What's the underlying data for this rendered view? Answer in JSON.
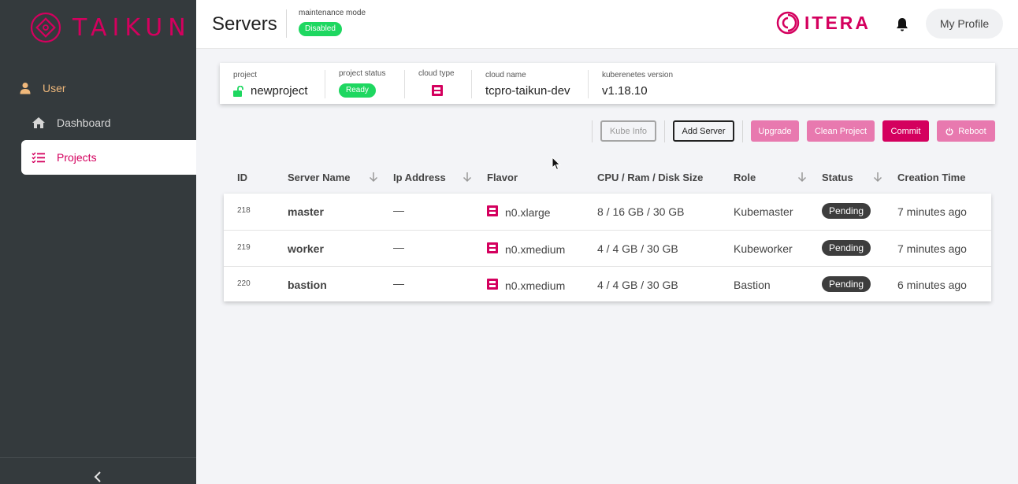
{
  "app": {
    "brand": "TAIKUN",
    "partner_brand": "ITERA",
    "accent_color": "#d4005e"
  },
  "sidebar": {
    "items": [
      {
        "label": "User",
        "icon": "user-icon"
      },
      {
        "label": "Dashboard",
        "icon": "home-icon"
      },
      {
        "label": "Projects",
        "icon": "list-icon",
        "active": true
      }
    ],
    "collapse_icon": "chevron-left-icon"
  },
  "header": {
    "title": "Servers",
    "maintenance_label": "maintenance mode",
    "maintenance_value": "Disabled",
    "profile_label": "My Profile",
    "bell_icon": "bell-icon"
  },
  "project_info": {
    "project_label": "project",
    "project_value": "newproject",
    "status_label": "project status",
    "status_value": "Ready",
    "cloud_type_label": "cloud type",
    "cloud_name_label": "cloud name",
    "cloud_name_value": "tcpro-taikun-dev",
    "k8s_label": "kuberenetes version",
    "k8s_value": "v1.18.10"
  },
  "actions": {
    "kube_info": "Kube Info",
    "add_server": "Add Server",
    "upgrade": "Upgrade",
    "clean_project": "Clean Project",
    "commit": "Commit",
    "reboot": "Reboot"
  },
  "table": {
    "columns": [
      "ID",
      "Server Name",
      "Ip Address",
      "Flavor",
      "CPU / Ram / Disk Size",
      "Role",
      "Status",
      "Creation Time"
    ],
    "rows": [
      {
        "id": "218",
        "name": "master",
        "ip": "—",
        "flavor": "n0.xlarge",
        "spec": "8 / 16 GB / 30 GB",
        "role": "Kubemaster",
        "status": "Pending",
        "created": "7 minutes ago"
      },
      {
        "id": "219",
        "name": "worker",
        "ip": "—",
        "flavor": "n0.xmedium",
        "spec": "4 / 4 GB / 30 GB",
        "role": "Kubeworker",
        "status": "Pending",
        "created": "7 minutes ago"
      },
      {
        "id": "220",
        "name": "bastion",
        "ip": "—",
        "flavor": "n0.xmedium",
        "spec": "4 / 4 GB / 30 GB",
        "role": "Bastion",
        "status": "Pending",
        "created": "6 minutes ago"
      }
    ]
  }
}
